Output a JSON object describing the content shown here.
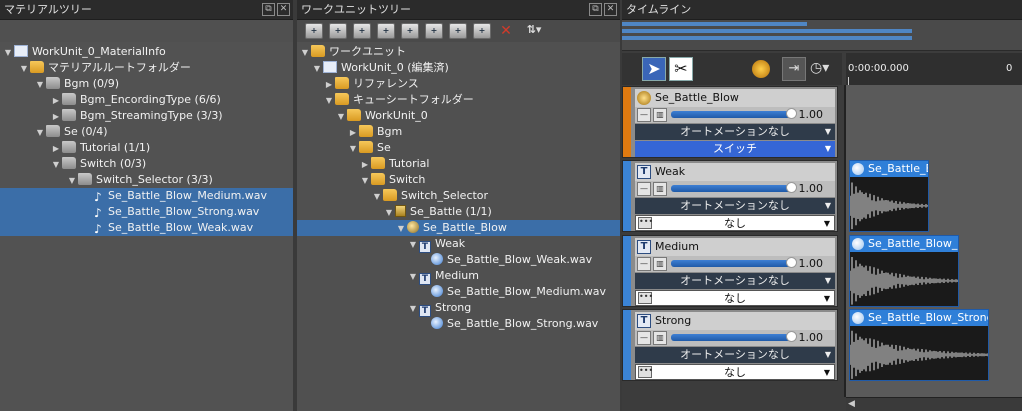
{
  "material_tree": {
    "title": "マテリアルツリー",
    "rows": [
      {
        "label": "WorkUnit_0_MaterialInfo",
        "indent": 0,
        "icon": "workunit-icon",
        "arrow": "▼",
        "sel": false
      },
      {
        "label": "マテリアルルートフォルダー",
        "indent": 1,
        "icon": "folder-icon",
        "arrow": "▼",
        "sel": false
      },
      {
        "label": "Bgm (0/9)",
        "indent": 2,
        "icon": "folder-grey-icon",
        "arrow": "▼",
        "sel": false
      },
      {
        "label": "Bgm_EncordingType (6/6)",
        "indent": 3,
        "icon": "folder-grey-icon",
        "arrow": "▶",
        "sel": false
      },
      {
        "label": "Bgm_StreamingType (3/3)",
        "indent": 3,
        "icon": "folder-grey-icon",
        "arrow": "▶",
        "sel": false
      },
      {
        "label": "Se (0/4)",
        "indent": 2,
        "icon": "folder-grey-icon",
        "arrow": "▼",
        "sel": false
      },
      {
        "label": "Tutorial (1/1)",
        "indent": 3,
        "icon": "folder-grey-icon",
        "arrow": "▶",
        "sel": false
      },
      {
        "label": "Switch (0/3)",
        "indent": 3,
        "icon": "folder-grey-icon",
        "arrow": "▼",
        "sel": false
      },
      {
        "label": "Switch_Selector (3/3)",
        "indent": 4,
        "icon": "folder-grey-icon",
        "arrow": "▼",
        "sel": false
      },
      {
        "label": "Se_Battle_Blow_Medium.wav",
        "indent": 5,
        "icon": "music-note-icon",
        "arrow": "",
        "sel": true
      },
      {
        "label": "Se_Battle_Blow_Strong.wav",
        "indent": 5,
        "icon": "music-note-icon",
        "arrow": "",
        "sel": true
      },
      {
        "label": "Se_Battle_Blow_Weak.wav",
        "indent": 5,
        "icon": "music-note-icon",
        "arrow": "",
        "sel": true
      }
    ]
  },
  "workunit_tree": {
    "title": "ワークユニットツリー",
    "rows": [
      {
        "label": "ワークユニット",
        "indent": 0,
        "icon": "folder-icon",
        "arrow": "▼",
        "sel": false
      },
      {
        "label": "WorkUnit_0 (編集済)",
        "indent": 1,
        "icon": "workunit-icon",
        "arrow": "▼",
        "sel": false
      },
      {
        "label": "リファレンス",
        "indent": 2,
        "icon": "folder-icon",
        "arrow": "▶",
        "sel": false
      },
      {
        "label": "キューシートフォルダー",
        "indent": 2,
        "icon": "folder-icon",
        "arrow": "▼",
        "sel": false
      },
      {
        "label": "WorkUnit_0",
        "indent": 3,
        "icon": "folder-icon",
        "arrow": "▼",
        "sel": false
      },
      {
        "label": "Bgm",
        "indent": 4,
        "icon": "folder-icon",
        "arrow": "▶",
        "sel": false
      },
      {
        "label": "Se",
        "indent": 4,
        "icon": "folder-icon",
        "arrow": "▼",
        "sel": false
      },
      {
        "label": "Tutorial",
        "indent": 5,
        "icon": "folder-icon",
        "arrow": "▶",
        "sel": false
      },
      {
        "label": "Switch",
        "indent": 5,
        "icon": "folder-icon",
        "arrow": "▼",
        "sel": false
      },
      {
        "label": "Switch_Selector",
        "indent": 6,
        "icon": "folder-icon",
        "arrow": "▼",
        "sel": false
      },
      {
        "label": "Se_Battle (1/1)",
        "indent": 7,
        "icon": "cuesheet-icon",
        "arrow": "▼",
        "sel": false
      },
      {
        "label": "Se_Battle_Blow",
        "indent": 8,
        "icon": "cue-icon",
        "arrow": "▼",
        "sel": true
      },
      {
        "label": "Weak",
        "indent": 9,
        "icon": "track-t-icon",
        "arrow": "▼",
        "sel": false
      },
      {
        "label": "Se_Battle_Blow_Weak.wav",
        "indent": 10,
        "icon": "waveform-icon",
        "arrow": "",
        "sel": false
      },
      {
        "label": "Medium",
        "indent": 9,
        "icon": "track-t-icon",
        "arrow": "▼",
        "sel": false
      },
      {
        "label": "Se_Battle_Blow_Medium.wav",
        "indent": 10,
        "icon": "waveform-icon",
        "arrow": "",
        "sel": false
      },
      {
        "label": "Strong",
        "indent": 9,
        "icon": "track-t-icon",
        "arrow": "▼",
        "sel": false
      },
      {
        "label": "Se_Battle_Blow_Strong.wav",
        "indent": 10,
        "icon": "waveform-icon",
        "arrow": "",
        "sel": false
      }
    ],
    "toolbar": [
      "new-workunit-icon",
      "new-folder-icon",
      "new-cuesheet-icon",
      "new-cue-icon",
      "new-track-icon",
      "new-material-icon",
      "new-marker-icon",
      "new-link-icon",
      "delete-icon",
      "sort-icon"
    ]
  },
  "timeline": {
    "title": "タイムライン",
    "time_label": "0:00:00.000",
    "tracks": [
      {
        "name": "Se_Battle_Blow",
        "volume": "1.00",
        "automation": "オートメーションなし",
        "extra": "スイッチ",
        "stripe": "#e07a10",
        "kind": "cue"
      },
      {
        "name": "Weak",
        "volume": "1.00",
        "automation": "オートメーションなし",
        "extra": "なし",
        "stripe": "#3b84d6",
        "kind": "track"
      },
      {
        "name": "Medium",
        "volume": "1.00",
        "automation": "オートメーションなし",
        "extra": "なし",
        "stripe": "#3b84d6",
        "kind": "track"
      },
      {
        "name": "Strong",
        "volume": "1.00",
        "automation": "オートメーションなし",
        "extra": "なし",
        "stripe": "#3b84d6",
        "kind": "track"
      }
    ],
    "clips": [
      {
        "label": "Se_Battle_B"
      },
      {
        "label": "Se_Battle_Blow_M"
      },
      {
        "label": "Se_Battle_Blow_Strong"
      }
    ]
  }
}
